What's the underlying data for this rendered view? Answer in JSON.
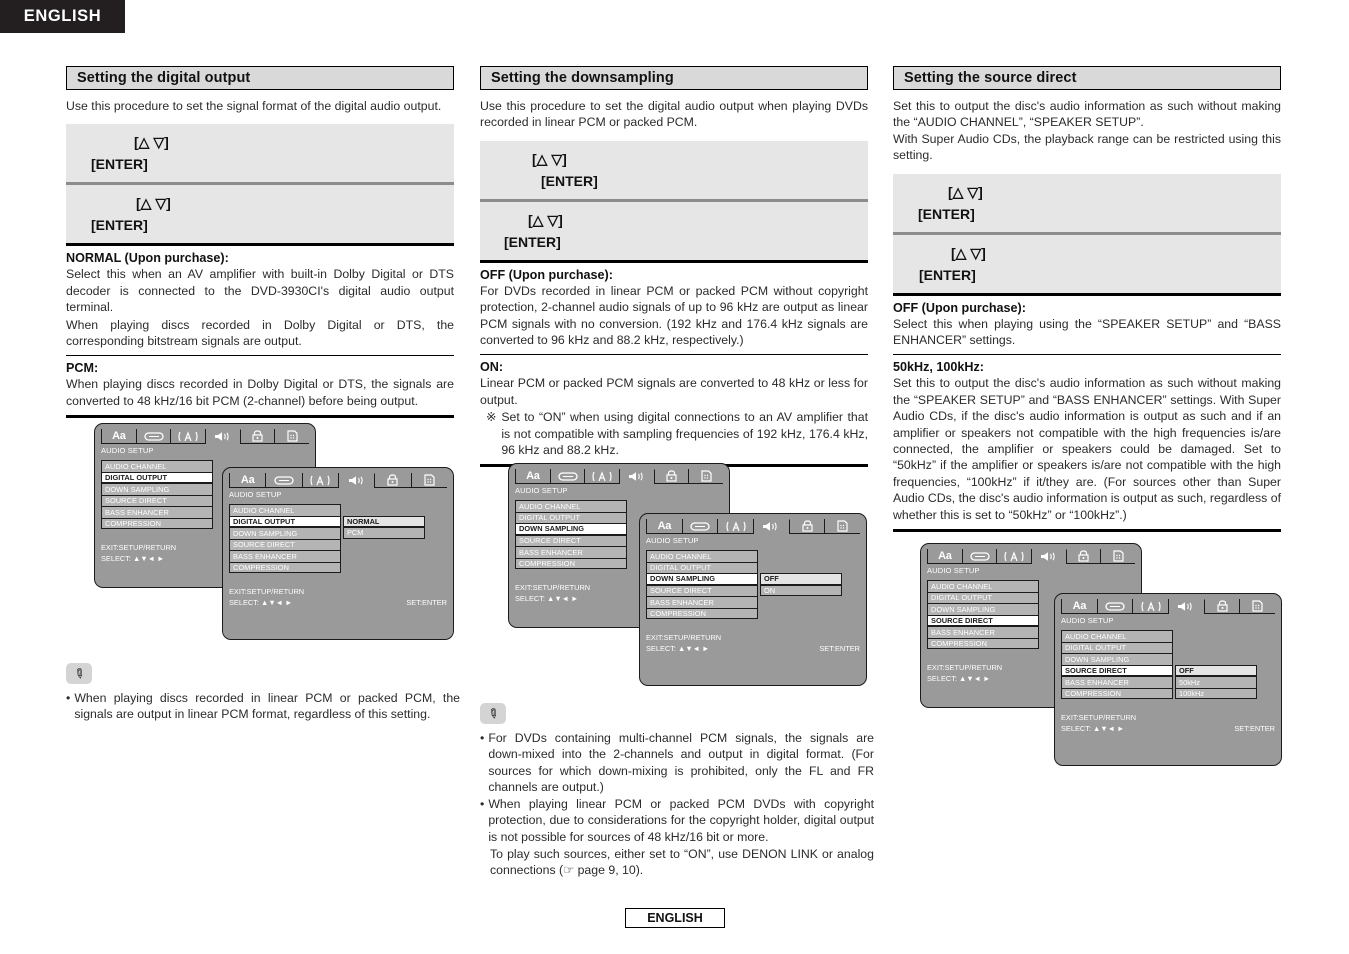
{
  "language_tab": "ENGLISH",
  "footer": "ENGLISH",
  "osd_tabs": [
    "Aa",
    "disc-icon",
    "parental-icon",
    "audio-icon",
    "lock-icon",
    "others-icon"
  ],
  "osd_common": {
    "title": "AUDIO SETUP",
    "menu_items": [
      "AUDIO CHANNEL",
      "DIGITAL OUTPUT",
      "DOWN SAMPLING",
      "SOURCE DIRECT",
      "BASS ENHANCER",
      "COMPRESSION"
    ],
    "exit_label": "EXIT:SETUP/RETURN",
    "select_label": "SELECT: ▲▼◄ ►",
    "set_label": "SET:ENTER"
  },
  "keys": {
    "arrows": "[△ ▽]",
    "enter": "[ENTER]"
  },
  "columns": [
    {
      "heading": "Setting the digital output",
      "intro": "Use this procedure to set the signal format of the digital audio output.",
      "options": [
        {
          "title": "NORMAL (Upon purchase):",
          "paragraphs": [
            "Select this when an AV amplifier with built-in Dolby Digital or DTS decoder is connected to the DVD-3930CI's digital audio output terminal.",
            "When playing discs recorded in Dolby Digital or DTS, the corresponding bitstream signals are output."
          ]
        },
        {
          "title": "PCM:",
          "paragraphs": [
            "When playing discs recorded in Dolby Digital or DTS, the signals are converted to 48 kHz/16 bit PCM (2-channel) before being output."
          ]
        }
      ],
      "osd_highlight": "DIGITAL OUTPUT",
      "osd_values": [
        "NORMAL",
        "PCM"
      ],
      "osd_value_selected": "NORMAL",
      "osd_value_offset": 1,
      "notes": [
        "When playing discs recorded in linear PCM or packed PCM, the signals are output in linear PCM format, regardless of this setting."
      ]
    },
    {
      "heading": "Setting the downsampling",
      "intro": "Use this procedure to set the digital audio output when playing DVDs recorded in linear PCM or packed PCM.",
      "options": [
        {
          "title": "OFF (Upon purchase):",
          "paragraphs": [
            "For DVDs recorded in linear PCM or packed PCM without copyright protection, 2-channel audio signals of up to 96 kHz are output as linear PCM signals with no conversion. (192 kHz and 176.4 kHz signals are converted to 96 kHz and 88.2 kHz, respectively.)"
          ]
        },
        {
          "title": "ON:",
          "paragraphs": [
            "Linear PCM or packed PCM signals are converted to 48 kHz or less for output."
          ],
          "marked_note": {
            "marker": "※",
            "text": "Set to “ON” when using digital connections to an AV amplifier that is not compatible with sampling frequencies of 192 kHz, 176.4 kHz, 96 kHz and 88.2 kHz."
          }
        }
      ],
      "osd_highlight": "DOWN SAMPLING",
      "osd_values": [
        "OFF",
        "ON"
      ],
      "osd_value_selected": "OFF",
      "osd_value_offset": 2,
      "notes": [
        "For DVDs containing multi-channel PCM signals, the signals are down-mixed into the 2-channels and output in digital format. (For sources for which down-mixing is prohibited, only the FL and FR channels are output.)",
        "When playing linear PCM or packed PCM DVDs with copyright protection, due to considerations for the copyright holder, digital output is not possible for sources of 48 kHz/16 bit or more."
      ],
      "note_subline": "To play such sources, either set to “ON”, use DENON LINK or analog connections (☞ page 9, 10)."
    },
    {
      "heading": "Setting the source direct",
      "intro": "Set this to output the disc's audio information as such without making the “AUDIO CHANNEL”, “SPEAKER SETUP”.\nWith Super Audio CDs, the playback range can be restricted using this setting.",
      "options": [
        {
          "title": "OFF (Upon purchase):",
          "paragraphs": [
            "Select this when playing using the “SPEAKER SETUP” and “BASS ENHANCER” settings."
          ]
        },
        {
          "title": "50kHz, 100kHz:",
          "paragraphs": [
            "Set this to output the disc's audio information as such without making the “SPEAKER SETUP” and “BASS ENHANCER” settings. With Super Audio CDs, if the disc's audio information is output as such and if an amplifier or speakers not compatible with the high frequencies is/are connected, the amplifier or speakers could be damaged. Set to “50kHz” if the amplifier or speakers is/are not compatible with the high frequencies, “100kHz” if it/they are. (For sources other than Super Audio CDs, the disc's audio information is output as such, regardless of whether this is set to “50kHz” or “100kHz”.)"
          ]
        }
      ],
      "osd_highlight": "SOURCE DIRECT",
      "osd_values": [
        "OFF",
        "50kHz",
        "100kHz"
      ],
      "osd_value_selected": "OFF",
      "osd_value_offset": 3,
      "notes": []
    }
  ]
}
